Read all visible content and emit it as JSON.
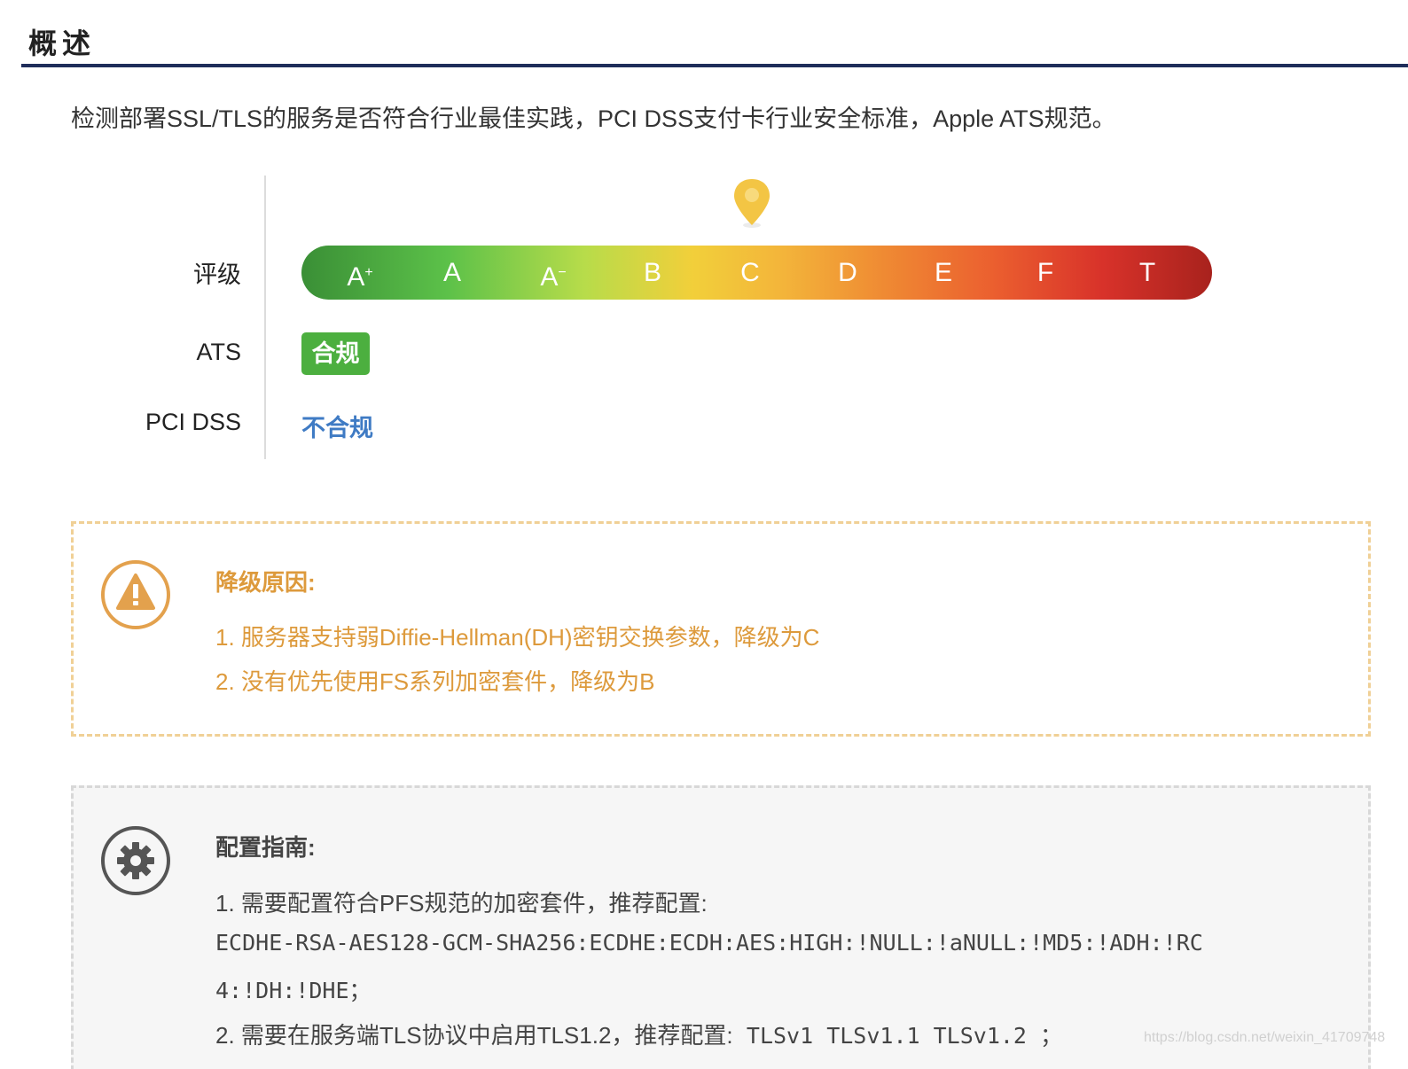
{
  "section": {
    "title": "概述"
  },
  "description": "检测部署SSL/TLS的服务是否符合行业最佳实践，PCI DSS支付卡行业安全标准，Apple ATS规范。",
  "rating": {
    "label": "评级",
    "current_grade": "C",
    "grades": [
      "A+",
      "A",
      "A-",
      "B",
      "C",
      "D",
      "E",
      "F",
      "T"
    ],
    "bar_colors": [
      "#3a8f36",
      "#5cc149",
      "#b7dc4a",
      "#f2cf3a",
      "#ef8a33",
      "#eb5f2f",
      "#d8322a",
      "#a8221d"
    ],
    "pin_color": "#f3c544"
  },
  "ats": {
    "label": "ATS",
    "value": "合规",
    "color": "#4caf3f"
  },
  "pci": {
    "label": "PCI DSS",
    "value": "不合规",
    "color": "#3f7bc4"
  },
  "downgrade": {
    "title": "降级原因:",
    "icon": "warning-icon",
    "color": "#dd9a3c",
    "items": [
      "1. 服务器支持弱Diffie-Hellman(DH)密钥交换参数，降级为C",
      "2. 没有优先使用FS系列加密套件，降级为B"
    ]
  },
  "guide": {
    "title": "配置指南:",
    "icon": "gear-icon",
    "item1_text": "1. 需要配置符合PFS规范的加密套件，推荐配置:",
    "cipher_line1": "ECDHE-RSA-AES128-GCM-SHA256:ECDHE:ECDH:AES:HIGH:!NULL:!aNULL:!MD5:!ADH:!RC",
    "cipher_line2": "4:!DH:!DHE；",
    "item2_text": "2. 需要在服务端TLS协议中启用TLS1.2，推荐配置:",
    "item2_code": "TLSv1 TLSv1.1 TLSv1.2 ；"
  },
  "watermark": "https://blog.csdn.net/weixin_41709748"
}
